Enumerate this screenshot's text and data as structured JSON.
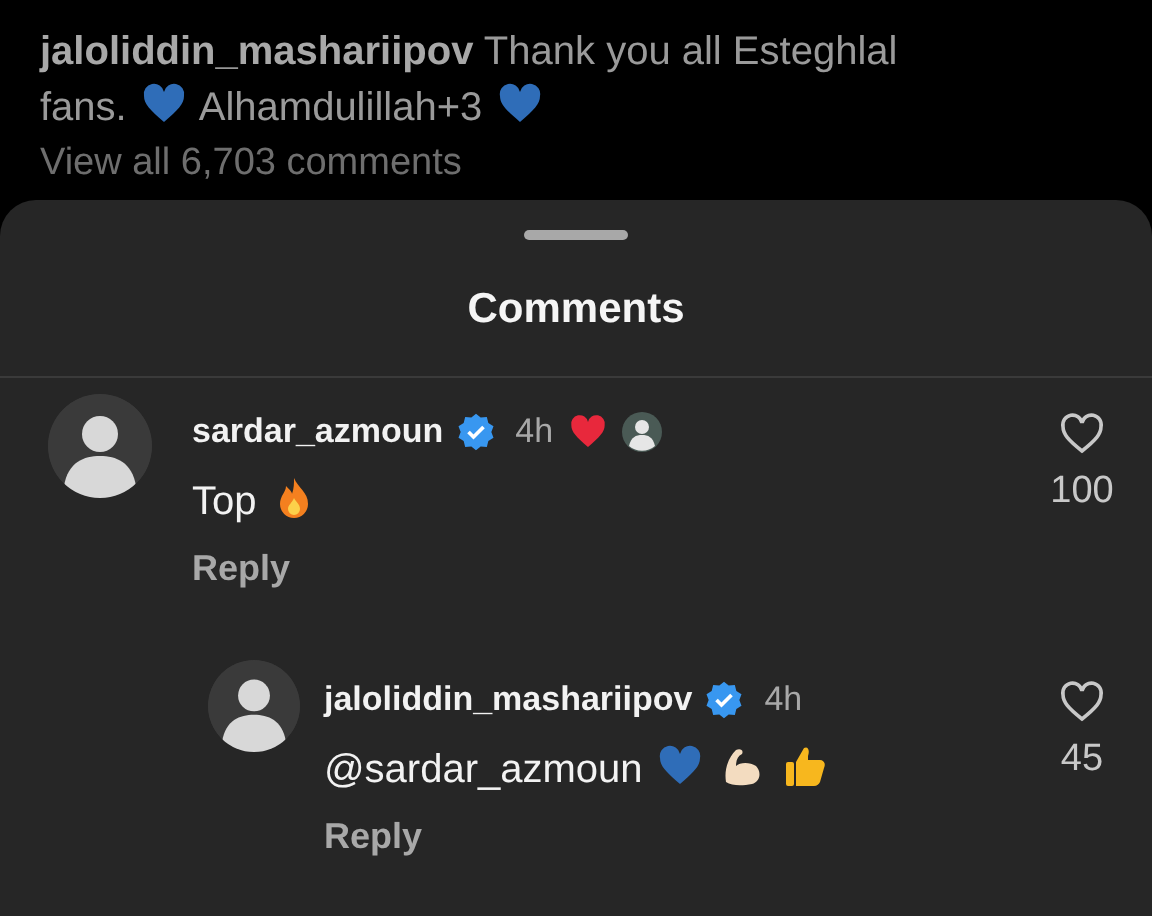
{
  "post": {
    "caption_lines": [
      [
        {
          "kind": "username",
          "text": "jaloliddin_mashariipov"
        },
        {
          "kind": "text",
          "text": "Thank you all Esteghlal"
        }
      ],
      [
        {
          "kind": "text",
          "text": "fans."
        },
        {
          "kind": "blue-heart"
        },
        {
          "kind": "text",
          "text": "Alhamdulillah+3"
        },
        {
          "kind": "blue-heart"
        }
      ]
    ],
    "view_all": "View all 6,703 comments"
  },
  "sheet": {
    "title": "Comments"
  },
  "comments": [
    {
      "username": "sardar_azmoun",
      "verified": true,
      "time": "4h",
      "liked_by_author": true,
      "body": [
        {
          "kind": "text",
          "text": "Top"
        },
        {
          "kind": "fire"
        }
      ],
      "reply": "Reply",
      "likes": "100",
      "liked": false,
      "children": [
        {
          "username": "jaloliddin_mashariipov",
          "verified": true,
          "time": "4h",
          "liked_by_author": false,
          "body": [
            {
              "kind": "text",
              "text": "@sardar_azmoun"
            },
            {
              "kind": "blue-heart"
            },
            {
              "kind": "muscle"
            },
            {
              "kind": "thumbs-up"
            }
          ],
          "reply": "Reply",
          "likes": "45",
          "liked": false
        }
      ]
    }
  ]
}
